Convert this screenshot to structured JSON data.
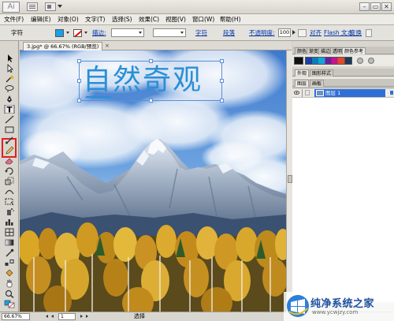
{
  "titlebar": {
    "app_logo": "Ai",
    "buttons": {
      "minimize": "–",
      "maximize": "▭",
      "close": "✕"
    }
  },
  "menubar": {
    "items": [
      "文件(F)",
      "编辑(E)",
      "对象(O)",
      "文字(T)",
      "选择(S)",
      "效果(C)",
      "视图(V)",
      "窗口(W)",
      "帮助(H)"
    ]
  },
  "controlbar": {
    "tool_label": "字符",
    "stroke_label": "描边:",
    "char_link": "字符",
    "para_link": "段落",
    "opacity_label": "不透明度:",
    "opacity_value": "100",
    "align_link": "对齐",
    "flash_text_link": "Flash 文本",
    "transform_link": "变换",
    "fill_color": "#1aa0e8"
  },
  "document": {
    "tab_title": "3.jpg* @ 66.67% (RGB/预览)",
    "close": "×",
    "text_object": "自然奇观",
    "text_color": "#2a8fd6"
  },
  "tools": {
    "highlighted": "type-tool"
  },
  "panels": {
    "top_tabs": [
      "颜色",
      "渐变",
      "描边",
      "透明",
      "颜色参考"
    ],
    "appearance_tabs": [
      "外观",
      "图形样式"
    ],
    "layers_tabs": [
      "图层",
      "画板"
    ],
    "layer_name": "图层 1"
  },
  "statusbar": {
    "zoom": "66.67%",
    "page": "1",
    "tool": "选择"
  },
  "watermark": {
    "title": "纯净系统之家",
    "url": "www.ycwjzy.com"
  }
}
